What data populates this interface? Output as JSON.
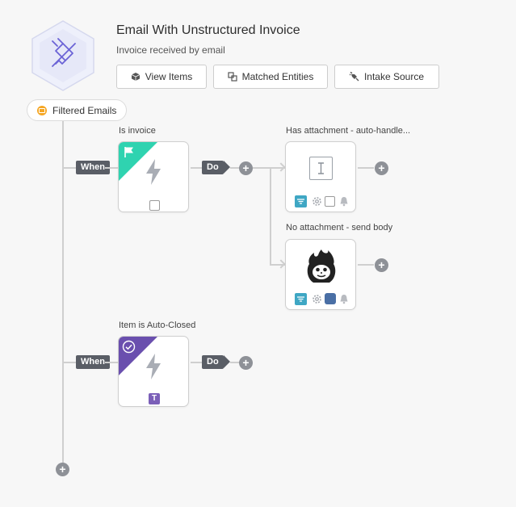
{
  "header": {
    "title": "Email With Unstructured Invoice",
    "subtitle": "Invoice received by email",
    "buttons": [
      {
        "label": "View Items",
        "icon": "cube-icon"
      },
      {
        "label": "Matched Entities",
        "icon": "entities-icon"
      },
      {
        "label": "Intake Source",
        "icon": "plug-icon"
      }
    ]
  },
  "source_pill": {
    "label": "Filtered Emails",
    "icon": "email-source-icon",
    "color": "#f5a623"
  },
  "rules": [
    {
      "label": "Is invoice",
      "when_label": "When",
      "do_label": "Do",
      "corner_color": "#2fd3b0",
      "corner_icon": "flag-icon",
      "actions": [
        {
          "label": "Has attachment - auto-handle...",
          "icon": "text-cursor-icon"
        },
        {
          "label": "No attachment - send body",
          "icon": "monkey-flame-icon"
        }
      ]
    },
    {
      "label": "Item is Auto-Closed",
      "when_label": "When",
      "do_label": "Do",
      "corner_color": "#6a4fae",
      "corner_icon": "check-circle-icon",
      "badge": "T"
    }
  ],
  "colors": {
    "line": "#cfcfcf",
    "tag": "#5a5e66",
    "plus": "#8e9197",
    "filter": "#3fa7c4",
    "blue_toggle": "#4a6fa5"
  }
}
